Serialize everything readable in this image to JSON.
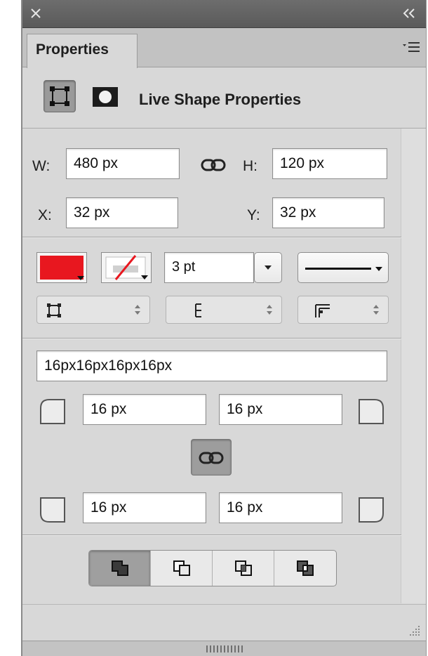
{
  "window": {
    "close_icon": "close-icon",
    "collapse_icon": "double-chevron-left-icon"
  },
  "tabs": {
    "active_label": "Properties",
    "menu_icon": "panel-menu-icon"
  },
  "shape_type": {
    "live_shape_button_icon": "live-shape-icon",
    "mask_button_icon": "mask-icon",
    "heading": "Live Shape Properties"
  },
  "dimensions": {
    "w_label": "W:",
    "w_value": "480 px",
    "h_label": "H:",
    "h_value": "120 px",
    "link_icon": "link-icon",
    "x_label": "X:",
    "x_value": "32 px",
    "y_label": "Y:",
    "y_value": "32 px"
  },
  "stroke": {
    "fill_color": "#e8171f",
    "stroke_color_state": "none",
    "stroke_width": "3 pt",
    "stroke_type": "solid-line",
    "align_type_icon": "stroke-align-icon",
    "cap_type_icon": "stroke-cap-icon",
    "corner_type_icon": "stroke-corner-icon"
  },
  "corners": {
    "summary": "16px16px16px16px",
    "top_left": "16 px",
    "top_right": "16 px",
    "bottom_left": "16 px",
    "bottom_right": "16 px",
    "link_icon": "link-icon"
  },
  "path_operations": {
    "selected_index": 0,
    "icons": [
      "combine-shapes-icon",
      "subtract-front-shape-icon",
      "intersect-shapes-icon",
      "exclude-overlapping-icon"
    ]
  }
}
